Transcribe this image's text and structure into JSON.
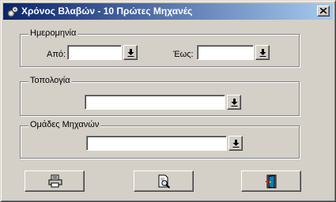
{
  "window": {
    "title": "Χρόνος Βλαβών - 10 Πρώτες Μηχανές",
    "title_icon": "gears-icon",
    "close_icon": "close-icon"
  },
  "date_group": {
    "legend": "Ημερομηνία",
    "from_label": "Από:",
    "from_value": "",
    "to_label": "Έως:",
    "to_value": ""
  },
  "topology_group": {
    "legend": "Τοπολογία",
    "value": ""
  },
  "machine_groups": {
    "legend": "Ομάδες Μηχανών",
    "value": ""
  },
  "buttons": {
    "print_icon": "printer-icon",
    "preview_icon": "print-preview-icon",
    "exit_icon": "exit-door-icon"
  },
  "colors": {
    "titlebar_start": "#0a246a",
    "titlebar_end": "#a6caf0",
    "face": "#d4d0c8"
  }
}
